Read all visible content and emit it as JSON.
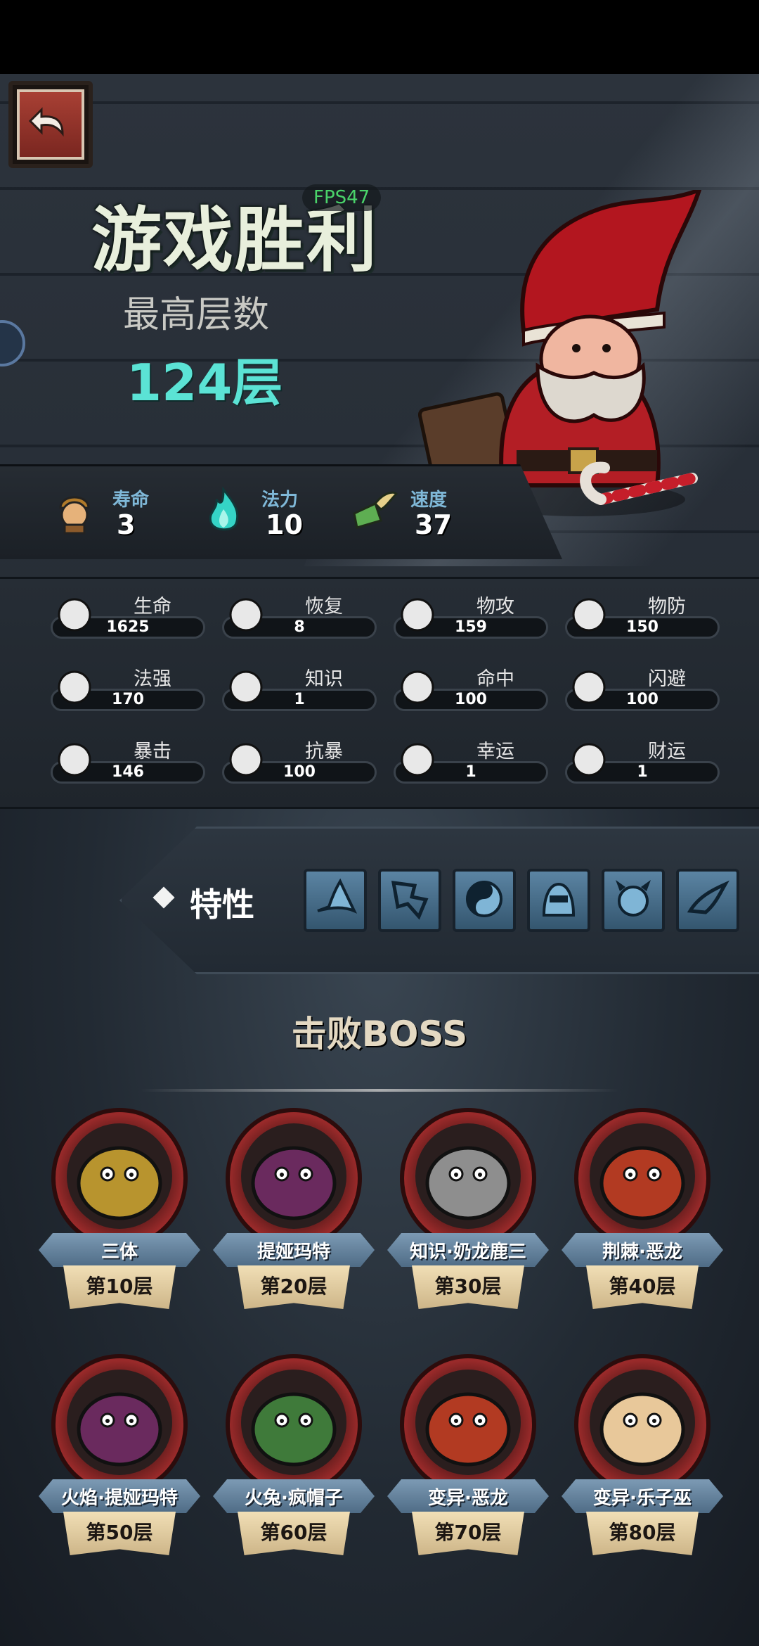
{
  "fps_label": "FPS47",
  "result": {
    "title": "游戏胜利",
    "floor_label": "最高层数",
    "floor_value": "124层"
  },
  "hero_stats": [
    {
      "label": "寿命",
      "value": "3",
      "icon": "warrior-head-icon"
    },
    {
      "label": "法力",
      "value": "10",
      "icon": "flame-icon"
    },
    {
      "label": "速度",
      "value": "37",
      "icon": "winged-boot-icon"
    }
  ],
  "attributes": [
    {
      "label": "生命",
      "value": "1625",
      "icon": "heart-icon"
    },
    {
      "label": "恢复",
      "value": "8",
      "icon": "heart-plus-icon"
    },
    {
      "label": "物攻",
      "value": "159",
      "icon": "sword-icon"
    },
    {
      "label": "物防",
      "value": "150",
      "icon": "armor-icon"
    },
    {
      "label": "法强",
      "value": "170",
      "icon": "staff-icon"
    },
    {
      "label": "知识",
      "value": "1",
      "icon": "book-icon"
    },
    {
      "label": "命中",
      "value": "100",
      "icon": "target-icon"
    },
    {
      "label": "闪避",
      "value": "100",
      "icon": "dash-arrow-icon"
    },
    {
      "label": "暴击",
      "value": "146",
      "icon": "crit-sword-icon"
    },
    {
      "label": "抗暴",
      "value": "100",
      "icon": "shell-shield-icon"
    },
    {
      "label": "幸运",
      "value": "1",
      "icon": "clover-icon"
    },
    {
      "label": "财运",
      "value": "1",
      "icon": "coin-icon"
    }
  ],
  "traits": {
    "title": "特性",
    "icons": [
      "wizard-hat-icon",
      "broken-scroll-icon",
      "yin-yang-icon",
      "hooded-thief-icon",
      "horned-demon-icon",
      "swirl-wing-icon"
    ]
  },
  "boss_section": {
    "title": "击败BOSS",
    "bosses": [
      {
        "name": "三体",
        "floor": "第10层",
        "color": "#b8942e"
      },
      {
        "name": "提娅玛特",
        "floor": "第20层",
        "color": "#6a2a5e"
      },
      {
        "name": "知识·奶龙鹿三",
        "floor": "第30层",
        "color": "#8e8e8e"
      },
      {
        "name": "荆棘·恶龙",
        "floor": "第40层",
        "color": "#b23a22"
      },
      {
        "name": "火焰·提娅玛特",
        "floor": "第50层",
        "color": "#6a2a5e"
      },
      {
        "name": "火兔·疯帽子",
        "floor": "第60层",
        "color": "#3f7a3a"
      },
      {
        "name": "变异·恶龙",
        "floor": "第70层",
        "color": "#b23a22"
      },
      {
        "name": "变异·乐子巫",
        "floor": "第80层",
        "color": "#e8c89a"
      }
    ]
  }
}
